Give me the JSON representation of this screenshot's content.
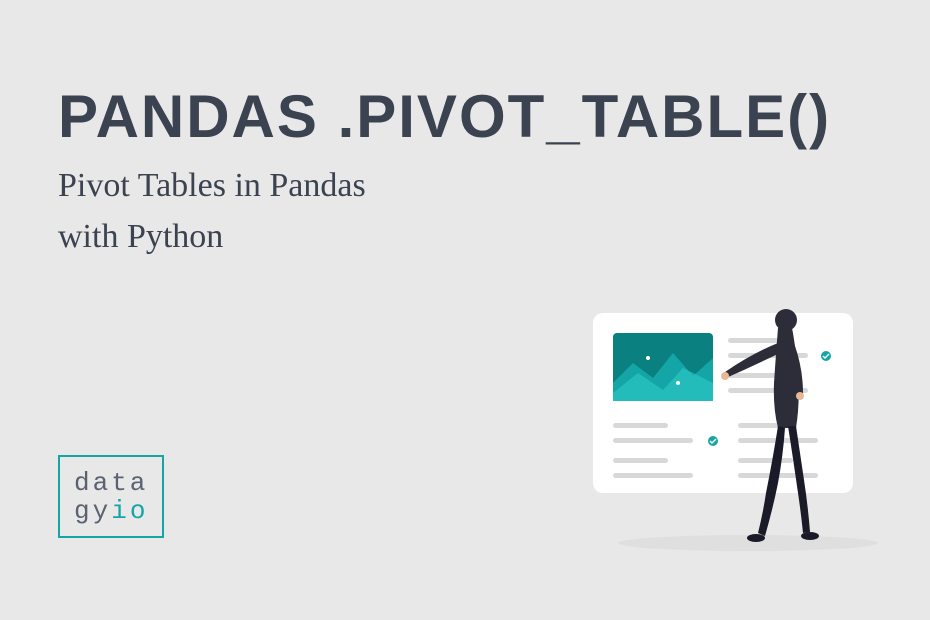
{
  "title": "Pandas .pivot_table()",
  "subtitle_line1": "Pivot Tables in Pandas",
  "subtitle_line2": "with Python",
  "logo": {
    "line1": "data",
    "line2_prefix": "gy",
    "line2_suffix": "io"
  },
  "colors": {
    "text": "#3b4250",
    "accent": "#14a6a6",
    "background": "#e8e8e8"
  }
}
